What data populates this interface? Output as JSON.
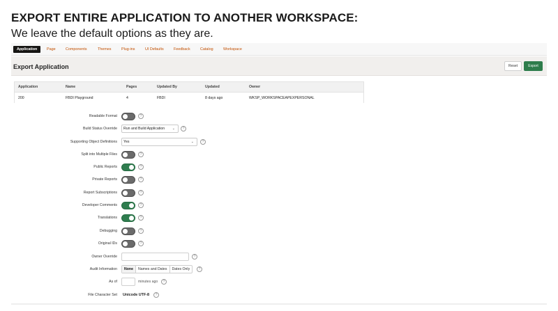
{
  "slide": {
    "title": "EXPORT ENTIRE APPLICATION TO ANOTHER WORKSPACE:",
    "subtitle": "We leave the default options as they are."
  },
  "tabs": [
    {
      "label": "Application",
      "active": true
    },
    {
      "label": "Page"
    },
    {
      "label": "Components"
    },
    {
      "label": "Themes"
    },
    {
      "label": "Plug-ins"
    },
    {
      "label": "UI Defaults"
    },
    {
      "label": "Feedback"
    },
    {
      "label": "Catalog"
    },
    {
      "label": "Workspace"
    }
  ],
  "header": {
    "title": "Export Application",
    "reset_label": "Reset",
    "export_label": "Export"
  },
  "grid": {
    "columns": [
      "Application",
      "Name",
      "Pages",
      "Updated By",
      "Updated",
      "Owner"
    ],
    "rows": [
      [
        "200",
        "FBDI Playground",
        "4",
        "FBDI",
        "8 days ago",
        "WKSP_WORKSPACEAPEXPERSONAL"
      ]
    ]
  },
  "form": {
    "readable_format": {
      "label": "Readable Format",
      "on": false
    },
    "build_status_override": {
      "label": "Build Status Override",
      "value": "Run and Build Application"
    },
    "supporting_objects": {
      "label": "Supporting Object Definitions",
      "value": "Yes"
    },
    "split_files": {
      "label": "Split into Multiple Files",
      "on": false
    },
    "public_reports": {
      "label": "Public Reports",
      "on": true
    },
    "private_reports": {
      "label": "Private Reports",
      "on": false
    },
    "report_subscriptions": {
      "label": "Report Subscriptions",
      "on": false
    },
    "developer_comments": {
      "label": "Developer Comments",
      "on": true
    },
    "translations": {
      "label": "Translations",
      "on": true
    },
    "debugging": {
      "label": "Debugging",
      "on": false
    },
    "original_ids": {
      "label": "Original IDs",
      "on": false
    },
    "owner_override": {
      "label": "Owner Override",
      "value": ""
    },
    "audit_information": {
      "label": "Audit Information",
      "options": [
        "None",
        "Names and Dates",
        "Dates Only"
      ],
      "selected": "None"
    },
    "as_of": {
      "label": "As of",
      "value": "",
      "suffix": "minutes ago"
    },
    "file_charset": {
      "label": "File Character Set",
      "value": "Unicode UTF-8"
    }
  },
  "colors": {
    "accent": "#2e7d4c",
    "tab_link": "#c24f00",
    "active_tab": "#161513"
  }
}
